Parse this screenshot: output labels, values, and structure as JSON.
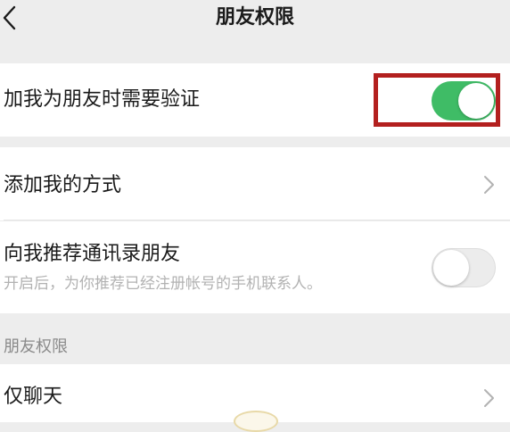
{
  "header": {
    "title": "朋友权限",
    "back_icon": "chevron-left-icon"
  },
  "settings": {
    "verify_friend": {
      "label": "加我为朋友时需要验证",
      "enabled": true
    },
    "add_methods": {
      "label": "添加我的方式"
    },
    "recommend_contacts": {
      "label": "向我推荐通讯录朋友",
      "description": "开启后，为你推荐已经注册帐号的手机联系人。",
      "enabled": false
    }
  },
  "section": {
    "title": "朋友权限"
  },
  "chat_only": {
    "label": "仅聊天"
  },
  "colors": {
    "toggle_on": "#3fbc66",
    "highlight": "#b3201f",
    "background": "#ededed"
  }
}
